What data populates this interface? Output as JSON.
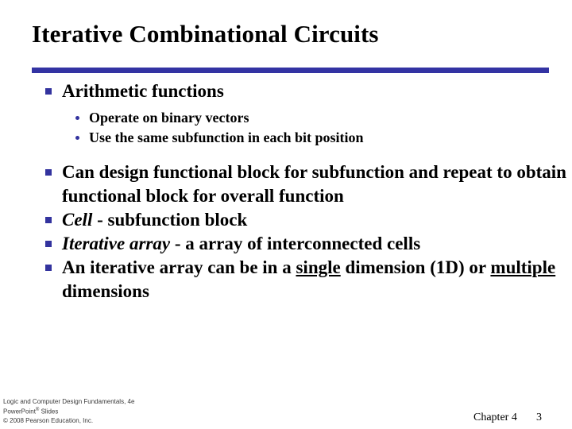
{
  "slide": {
    "title": "Iterative Combinational Circuits",
    "accent_color": "#3333a3",
    "bullet_marker_color": "#33339e",
    "background_color": "#ffffff",
    "text_color": "#000000"
  },
  "body": {
    "b1": {
      "text": "Arithmetic functions",
      "sub": [
        "Operate on binary vectors",
        "Use the same subfunction in each bit position"
      ]
    },
    "b2": {
      "text": "Can design functional block for subfunction and repeat to obtain functional block for overall function"
    },
    "b3": {
      "lead": "Cell",
      "rest": " - subfunction block"
    },
    "b4": {
      "lead": "Iterative array",
      "rest": " - a array of interconnected cells"
    },
    "b5": {
      "part1": "An iterative array can be in a ",
      "emph1": "single",
      "part2": " dimension (1D) or ",
      "emph2": "multiple",
      "part3": " dimensions"
    }
  },
  "footer": {
    "credit_line1": "Logic and Computer Design Fundamentals, 4e",
    "credit_line2_main": "PowerPoint",
    "credit_line2_sup": "®",
    "credit_line2_tail": " Slides",
    "credit_line3": "© 2008 Pearson Education, Inc.",
    "chapter": "Chapter 4",
    "page_number": "3"
  }
}
